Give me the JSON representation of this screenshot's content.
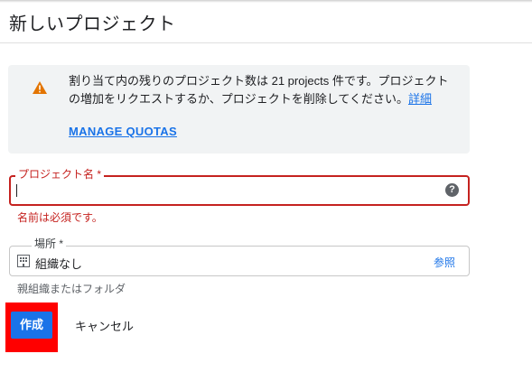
{
  "page": {
    "title": "新しいプロジェクト"
  },
  "quota": {
    "message": "割り当て内の残りのプロジェクト数は 21 projects 件です。プロジェクトの増加をリクエストするか、プロジェクトを削除してください。",
    "details_link": "詳細",
    "manage_link": "MANAGE QUOTAS"
  },
  "project_name": {
    "label": "プロジェクト名 *",
    "value": "",
    "error": "名前は必須です。"
  },
  "location": {
    "label": "場所 *",
    "value": "組織なし",
    "browse": "参照",
    "hint": "親組織またはフォルダ"
  },
  "actions": {
    "create": "作成",
    "cancel": "キャンセル"
  },
  "colors": {
    "accent": "#1a73e8",
    "error": "#c5221f",
    "warning": "#e37400",
    "highlight": "#ff0000"
  },
  "icons": {
    "warning": "warning-icon",
    "help": "help-icon",
    "organization": "organization-icon"
  }
}
